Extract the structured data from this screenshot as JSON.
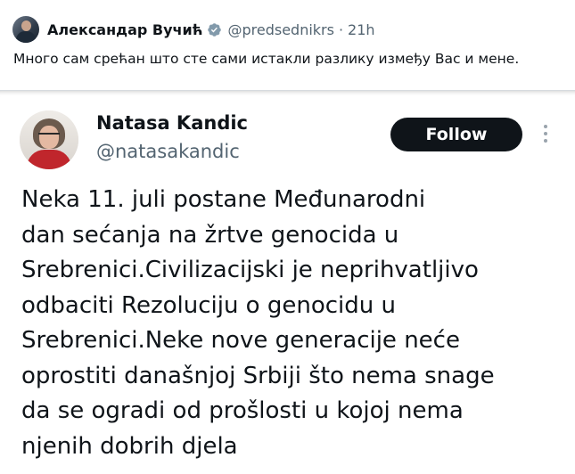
{
  "outer": {
    "name": "Александар Вучић",
    "handle": "@predsednikrs",
    "separator": "·",
    "time": "21h",
    "text": "Много сам срећан што сте сами истакли разлику између Вас и мене."
  },
  "quote": {
    "name": "Natasa Kandic",
    "handle": "@natasakandic",
    "follow_label": "Follow",
    "lines": [
      "Neka 11. juli postane Međunarodni",
      "dan sećanja na žrtve genocida u",
      "Srebrenici.Civilizacijski je neprihvatljivo",
      "odbaciti Rezoluciju o genocidu u",
      "Srebrenici.Neke nove generacije neće",
      "oprostiti današnjoj Srbiji što nema snage",
      "da se ogradi od prošlosti u kojoj nema",
      "njenih dobrih djela"
    ]
  },
  "colors": {
    "verified_badge": "#829aab",
    "text_primary": "#0f1419",
    "text_secondary": "#536471",
    "follow_bg": "#0f1419"
  },
  "icons": {
    "verified": "verified-badge-icon",
    "more": "more-vertical-icon"
  }
}
